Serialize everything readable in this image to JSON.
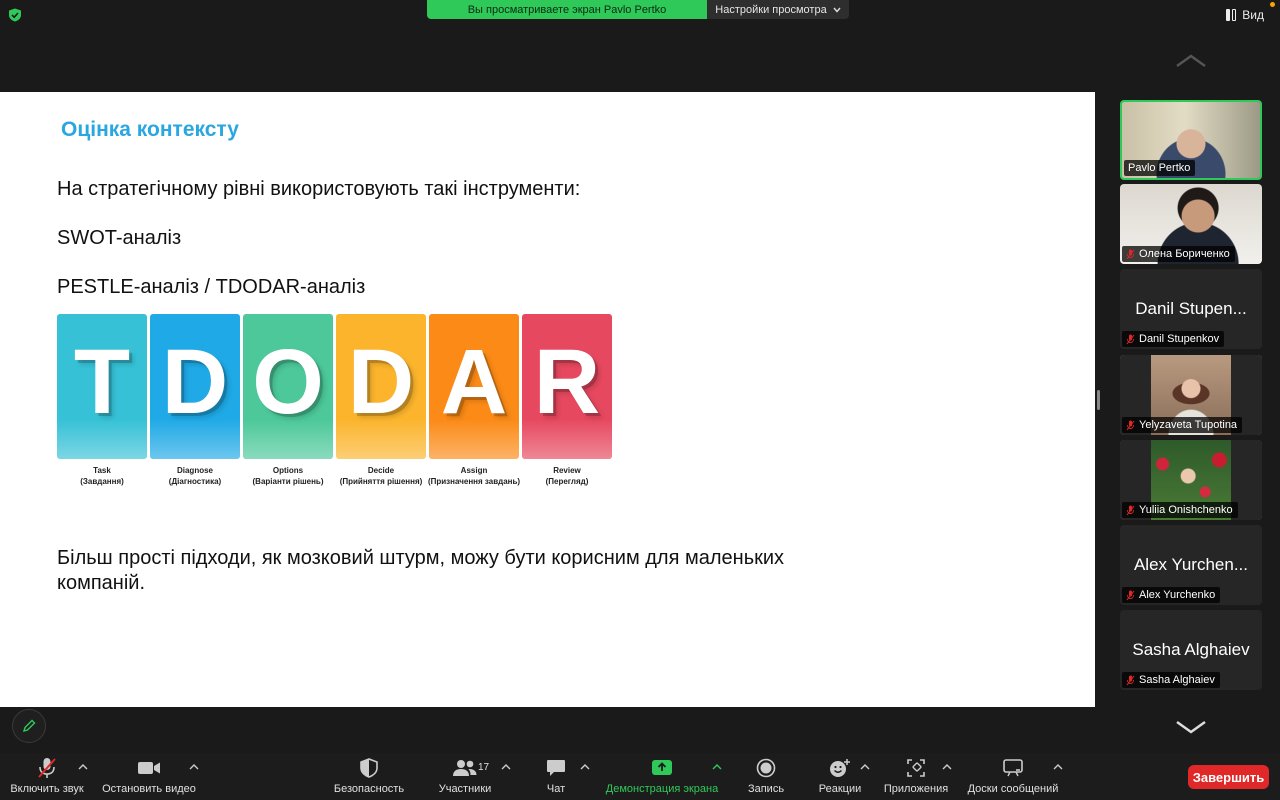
{
  "top": {
    "banner_viewing": "Вы просматриваете экран Pavlo Pertko",
    "banner_view_options": "Настройки просмотра",
    "view_label": "Вид"
  },
  "slide": {
    "title": "Оцінка контексту",
    "line1": "На стратегічному рівні використовують такі  інструменти:",
    "line2": "SWOT-аналіз",
    "line3": "PESTLE-аналіз / TDODAR-аналіз",
    "bottom": "Більш прості підходи, як мозковий штурм, можу бути корисним для маленьких компаній.",
    "tiles": [
      {
        "letter": "T",
        "cap1": "Task",
        "cap2": "(Завдання)",
        "color": "#36c1d6"
      },
      {
        "letter": "D",
        "cap1": "Diagnose",
        "cap2": "(Діагностика)",
        "color": "#1fa9e6"
      },
      {
        "letter": "O",
        "cap1": "Options",
        "cap2": "(Варіанти рішень)",
        "color": "#4cc89a"
      },
      {
        "letter": "D",
        "cap1": "Decide",
        "cap2": "(Прийняття рішення)",
        "color": "#fbb42c"
      },
      {
        "letter": "A",
        "cap1": "Assign",
        "cap2": "(Призначення завдань)",
        "color": "#fb8a16"
      },
      {
        "letter": "R",
        "cap1": "Review",
        "cap2": "(Перегляд)",
        "color": "#e6485f"
      }
    ]
  },
  "participants": [
    {
      "tag": "Pavlo Pertko",
      "big": "",
      "video": true,
      "muted": false,
      "active": true
    },
    {
      "tag": "Олена Бориченко",
      "big": "",
      "video": true,
      "muted": true,
      "active": false
    },
    {
      "tag": "Danil Stupenkov",
      "big": "Danil Stupen...",
      "video": false,
      "muted": true,
      "active": false
    },
    {
      "tag": "Yelyzaveta Tupotina",
      "big": "",
      "video": true,
      "muted": true,
      "active": false
    },
    {
      "tag": "Yuliia Onishchenko",
      "big": "",
      "video": true,
      "muted": true,
      "active": false
    },
    {
      "tag": "Alex Yurchenko",
      "big": "Alex Yurchen...",
      "video": false,
      "muted": true,
      "active": false
    },
    {
      "tag": "Sasha Alghaiev",
      "big": "Sasha Alghaiev",
      "video": false,
      "muted": true,
      "active": false
    }
  ],
  "toolbar": {
    "unmute": "Включить звук",
    "stop_video": "Остановить видео",
    "security": "Безопасность",
    "participants": "Участники",
    "participants_count": "17",
    "chat": "Чат",
    "share": "Демонстрация экрана",
    "record": "Запись",
    "reactions": "Реакции",
    "apps": "Приложения",
    "whiteboards": "Доски сообщений",
    "end": "Завершить"
  },
  "colors": {
    "accent_green": "#2fc95a",
    "end_red": "#e02828",
    "title_blue": "#2aa7e0"
  }
}
